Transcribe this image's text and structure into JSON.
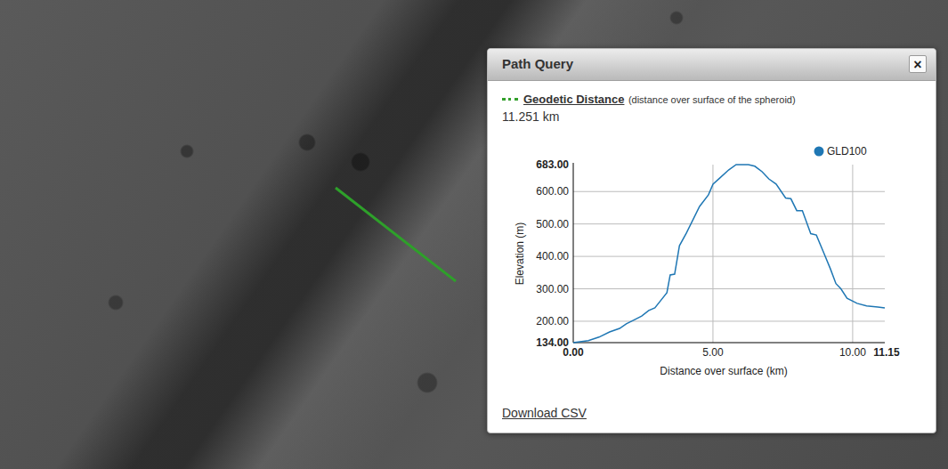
{
  "panel": {
    "title": "Path Query",
    "close": "×",
    "legend_label": "Geodetic Distance",
    "legend_note": "(distance over surface of the spheroid)",
    "distance": "11.251 km",
    "download": "Download CSV"
  },
  "chart": {
    "y_label": "Elevation (m)",
    "x_label": "Distance over surface (km)",
    "y_ticks": [
      {
        "label": "683.00",
        "kind": "limit"
      },
      {
        "label": "600.00",
        "kind": "grid"
      },
      {
        "label": "500.00",
        "kind": "grid"
      },
      {
        "label": "400.00",
        "kind": "grid"
      },
      {
        "label": "300.00",
        "kind": "grid"
      },
      {
        "label": "200.00",
        "kind": "grid"
      },
      {
        "label": "134.00",
        "kind": "limit"
      }
    ],
    "x_ticks": [
      {
        "label": "0.00",
        "kind": "limit"
      },
      {
        "label": "5.00",
        "kind": "grid"
      },
      {
        "label": "10.00",
        "kind": "grid"
      },
      {
        "label": "11.15",
        "kind": "limit"
      }
    ],
    "series": [
      {
        "name": "GLD100",
        "color": "#1f77b4",
        "distances": [
          0,
          0.54,
          0.92,
          1.3,
          1.66,
          1.9,
          2.2,
          2.45,
          2.7,
          2.92,
          3.15,
          3.35,
          3.47,
          3.63,
          3.8,
          4.05,
          4.3,
          4.52,
          4.84,
          5.0,
          5.25,
          5.57,
          5.83,
          6.27,
          6.5,
          6.76,
          7.0,
          7.26,
          7.6,
          7.79,
          8.0,
          8.2,
          8.5,
          8.7,
          8.97,
          9.2,
          9.4,
          9.58,
          9.8,
          10.16,
          10.5,
          10.9,
          11.15
        ],
        "values": [
          134,
          140,
          151,
          167,
          178,
          192,
          205,
          216,
          233,
          241,
          266,
          288,
          343,
          345,
          433,
          472,
          516,
          554,
          590,
          623,
          642,
          667,
          683,
          683,
          678,
          661,
          639,
          623,
          580,
          578,
          541,
          541,
          470,
          466,
          410,
          362,
          316,
          300,
          271,
          255,
          247,
          244,
          241
        ]
      }
    ]
  }
}
